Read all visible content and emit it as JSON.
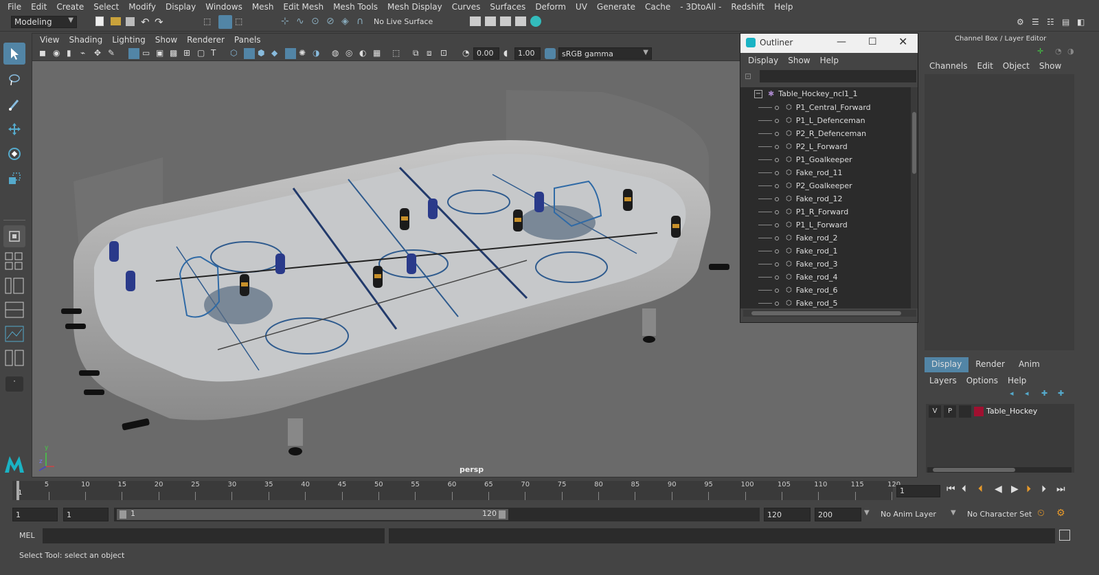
{
  "menubar": [
    "File",
    "Edit",
    "Create",
    "Select",
    "Modify",
    "Display",
    "Windows",
    "Mesh",
    "Edit Mesh",
    "Mesh Tools",
    "Mesh Display",
    "Curves",
    "Surfaces",
    "Deform",
    "UV",
    "Generate",
    "Cache",
    "- 3DtoAll -",
    "Redshift",
    "Help"
  ],
  "shelf": {
    "mode": "Modeling",
    "live_surface": "No Live Surface"
  },
  "viewport": {
    "menu": [
      "View",
      "Shading",
      "Lighting",
      "Show",
      "Renderer",
      "Panels"
    ],
    "exposure": "0.00",
    "gamma": "1.00",
    "color_space": "sRGB gamma",
    "camera_label": "persp",
    "axis_labels": {
      "y": "y",
      "z": "z"
    }
  },
  "outliner": {
    "title": "Outliner",
    "menu": [
      "Display",
      "Show",
      "Help"
    ],
    "root": "Table_Hockey_ncl1_1",
    "items": [
      "P1_Central_Forward",
      "P1_L_Defenceman",
      "P2_R_Defenceman",
      "P2_L_Forward",
      "P1_Goalkeeper",
      "Fake_rod_11",
      "P2_Goalkeeper",
      "Fake_rod_12",
      "P1_R_Forward",
      "P1_L_Forward",
      "Fake_rod_2",
      "Fake_rod_1",
      "Fake_rod_3",
      "Fake_rod_4",
      "Fake_rod_6",
      "Fake_rod_5"
    ]
  },
  "channelbox": {
    "title": "Channel Box / Layer Editor",
    "menu": [
      "Channels",
      "Edit",
      "Object",
      "Show"
    ],
    "tabs": [
      "Display",
      "Render",
      "Anim"
    ],
    "layer_menu": [
      "Layers",
      "Options",
      "Help"
    ],
    "layer": {
      "v": "V",
      "p": "P",
      "name": "Table_Hockey",
      "color": "#a01030"
    }
  },
  "timeline": {
    "ticks": [
      "5",
      "10",
      "15",
      "20",
      "25",
      "30",
      "35",
      "40",
      "45",
      "50",
      "55",
      "60",
      "65",
      "70",
      "75",
      "80",
      "85",
      "90",
      "95",
      "100",
      "105",
      "110",
      "115",
      "120"
    ],
    "first": "1",
    "current_frame": "1"
  },
  "range": {
    "start": "1",
    "anim_start": "1",
    "slider_start": "1",
    "slider_end": "120",
    "end": "120",
    "anim_end": "200",
    "anim_layer": "No Anim Layer",
    "character_set": "No Character Set"
  },
  "mel": {
    "label": "MEL"
  },
  "help_line": "Select Tool: select an object",
  "colors": {
    "accent": "#5285a6",
    "viewport_bg": "#6a6a6a",
    "panel": "#444444"
  }
}
